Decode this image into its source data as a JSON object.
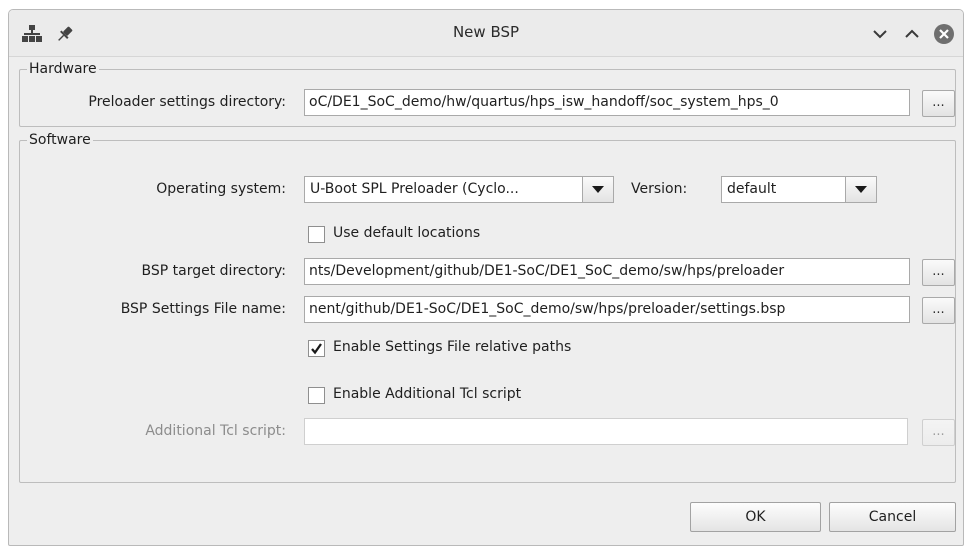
{
  "window": {
    "title": "New BSP"
  },
  "hardware": {
    "legend": "Hardware",
    "preloader_label": "Preloader settings directory:",
    "preloader_value": "oC/DE1_SoC_demo/hw/quartus/hps_isw_handoff/soc_system_hps_0",
    "browse_label": "..."
  },
  "software": {
    "legend": "Software",
    "os_label": "Operating system:",
    "os_value": "U-Boot SPL Preloader (Cyclo...",
    "version_label": "Version:",
    "version_value": "default",
    "use_default_locations": {
      "label": "Use default locations",
      "checked": false
    },
    "bsp_target_label": "BSP target directory:",
    "bsp_target_value": "nts/Development/github/DE1-SoC/DE1_SoC_demo/sw/hps/preloader",
    "bsp_settings_label": "BSP Settings File name:",
    "bsp_settings_value": "nent/github/DE1-SoC/DE1_SoC_demo/sw/hps/preloader/settings.bsp",
    "enable_relative_paths": {
      "label": "Enable Settings File relative paths",
      "checked": true
    },
    "enable_tcl": {
      "label": "Enable Additional Tcl script",
      "checked": false
    },
    "tcl_label": "Additional Tcl script:",
    "tcl_value": "",
    "browse_label": "..."
  },
  "buttons": {
    "ok": "OK",
    "cancel": "Cancel"
  },
  "icons": {
    "app": "sitemap-icon",
    "pin": "pin-icon",
    "minimize": "chevron-down-icon",
    "maximize": "chevron-up-icon",
    "close": "close-circle-icon"
  },
  "colors": {
    "check_mark": "#1a1a1a",
    "close_button": "#6f6f6f"
  }
}
